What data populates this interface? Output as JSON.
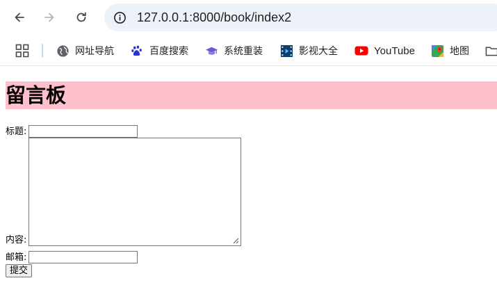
{
  "browser": {
    "url": "127.0.0.1:8000/book/index2",
    "bookmarks": [
      {
        "label": "网址导航",
        "icon": "globe-icon"
      },
      {
        "label": "百度搜索",
        "icon": "baidu-paw-icon"
      },
      {
        "label": "系统重装",
        "icon": "graduation-cap-icon"
      },
      {
        "label": "影视大全",
        "icon": "film-strip-icon"
      },
      {
        "label": "YouTube",
        "icon": "youtube-icon"
      },
      {
        "label": "地图",
        "icon": "maps-pin-icon"
      }
    ]
  },
  "page": {
    "title": "留言板",
    "title_bg": "#ffc0cb",
    "form": {
      "title_label": "标题:",
      "title_value": "",
      "content_label": "内容:",
      "content_value": "",
      "email_label": "邮箱:",
      "email_value": "",
      "submit_label": "提交"
    }
  }
}
